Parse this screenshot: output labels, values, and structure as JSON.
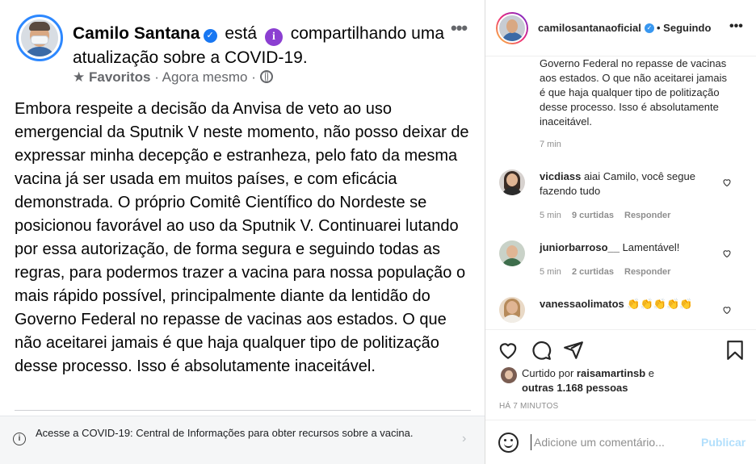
{
  "fb_post": {
    "author": "Camilo Santana",
    "action_pre": " está ",
    "action_post": " compartilhando uma atualização sobre a COVID-19.",
    "meta_favorites": "Favoritos",
    "meta_time": " · Agora mesmo · ",
    "more_label": "•••",
    "body": "Embora respeite a decisão da Anvisa de veto ao uso emergencial da Sputnik V neste momento, não posso deixar de expressar minha decepção e estranheza, pelo fato da mesma vacina já ser usada em muitos países, e com eficácia demonstrada. O próprio Comitê Científico do Nordeste se posicionou favorável ao uso da Sputnik V. Continuarei lutando por essa autorização, de forma segura e seguindo todas as regras, para podermos trazer a vacina para nossa população o mais rápido possível, principalmente diante da lentidão do Governo Federal no repasse de vacinas aos estados. O que não aceitarei jamais é que haja qualquer tipo de politização desse processo. Isso é absolutamente inaceitável.",
    "covid_notice": "Acesse a COVID-19: Central de Informações para obter recursos sobre a vacina."
  },
  "ig": {
    "username": "camilosantanaoficial",
    "following": "• Seguindo",
    "more_label": "•••",
    "caption_tail": "Governo Federal no repasse de vacinas aos estados. O que não aceitarei jamais é que haja qualquer tipo de politização desse processo. Isso é absolutamente inaceitável.",
    "caption_time": "7 min",
    "comments": [
      {
        "user": "vicdiass",
        "text": " aiai Camilo, você segue fazendo tudo",
        "time": "5 min",
        "likes": "9 curtidas",
        "reply": "Responder"
      },
      {
        "user": "juniorbarroso__",
        "text": " Lamentável!",
        "time": "5 min",
        "likes": "2 curtidas",
        "reply": "Responder"
      },
      {
        "user": "vanessaolimatos",
        "text": " 👏👏👏👏👏",
        "time": "",
        "likes": "",
        "reply": ""
      }
    ],
    "liked_prefix": "Curtido por ",
    "liked_user": "raisamartinsb",
    "liked_mid": " e ",
    "liked_others": "outras 1.168 pessoas",
    "posted_ago": "HÁ 7 MINUTOS",
    "comment_placeholder": "Adicione um comentário...",
    "publish_label": "Publicar"
  },
  "colors": {
    "fb_blue": "#1877f2",
    "ig_link_disabled": "#b2dffc",
    "info_badge": "#8b3fd1"
  },
  "icons": [
    "verified-badge-icon",
    "info-badge-icon",
    "star-icon",
    "globe-icon",
    "info-circle-icon",
    "chevron-right-icon",
    "heart-icon",
    "comment-icon",
    "share-icon",
    "bookmark-icon",
    "emoji-icon"
  ]
}
